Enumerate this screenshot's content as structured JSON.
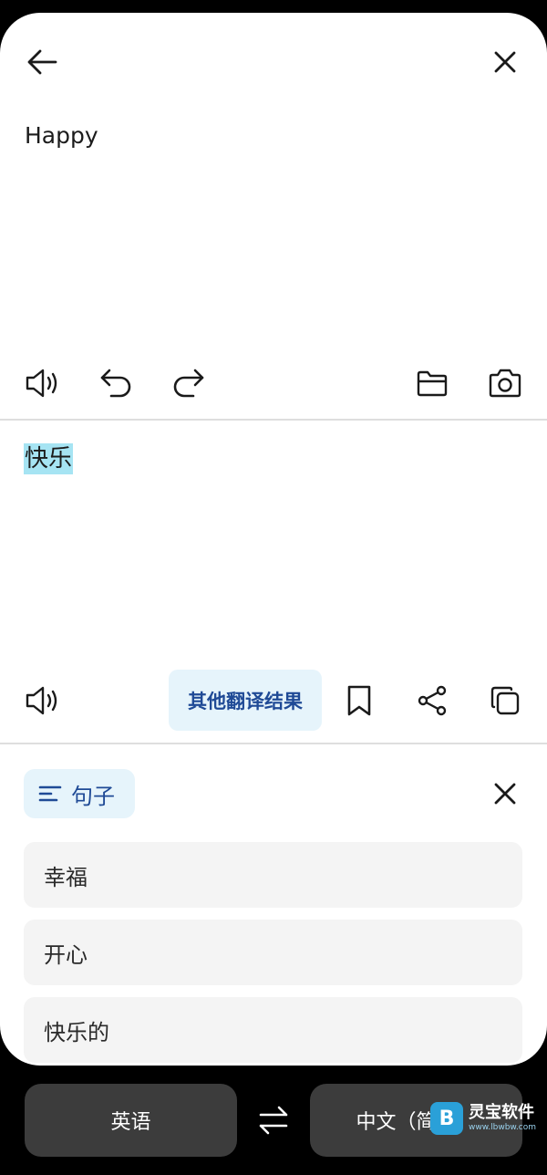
{
  "source": {
    "text": "Happy"
  },
  "target": {
    "text": "快乐"
  },
  "actions": {
    "other_results_label": "其他翻译结果"
  },
  "sentences": {
    "chip_label": "句子",
    "items": [
      "幸福",
      "开心",
      "快乐的"
    ]
  },
  "languages": {
    "source": "英语",
    "target": "中文（简体）"
  },
  "watermark": {
    "name": "灵宝软件",
    "url": "www.lbwbw.com",
    "logo_letter": "B"
  },
  "colors": {
    "accent": "#1f4a96",
    "chip_bg": "#e6f4fb",
    "highlight": "#a6e4f3",
    "bottom_bar": "#000000",
    "lang_button": "#3c3c3c"
  },
  "icons": [
    "back-arrow-icon",
    "close-icon",
    "speaker-icon",
    "undo-icon",
    "redo-icon",
    "folder-icon",
    "camera-icon",
    "bookmark-icon",
    "share-icon",
    "copy-icon",
    "sentences-icon",
    "swap-icon"
  ]
}
